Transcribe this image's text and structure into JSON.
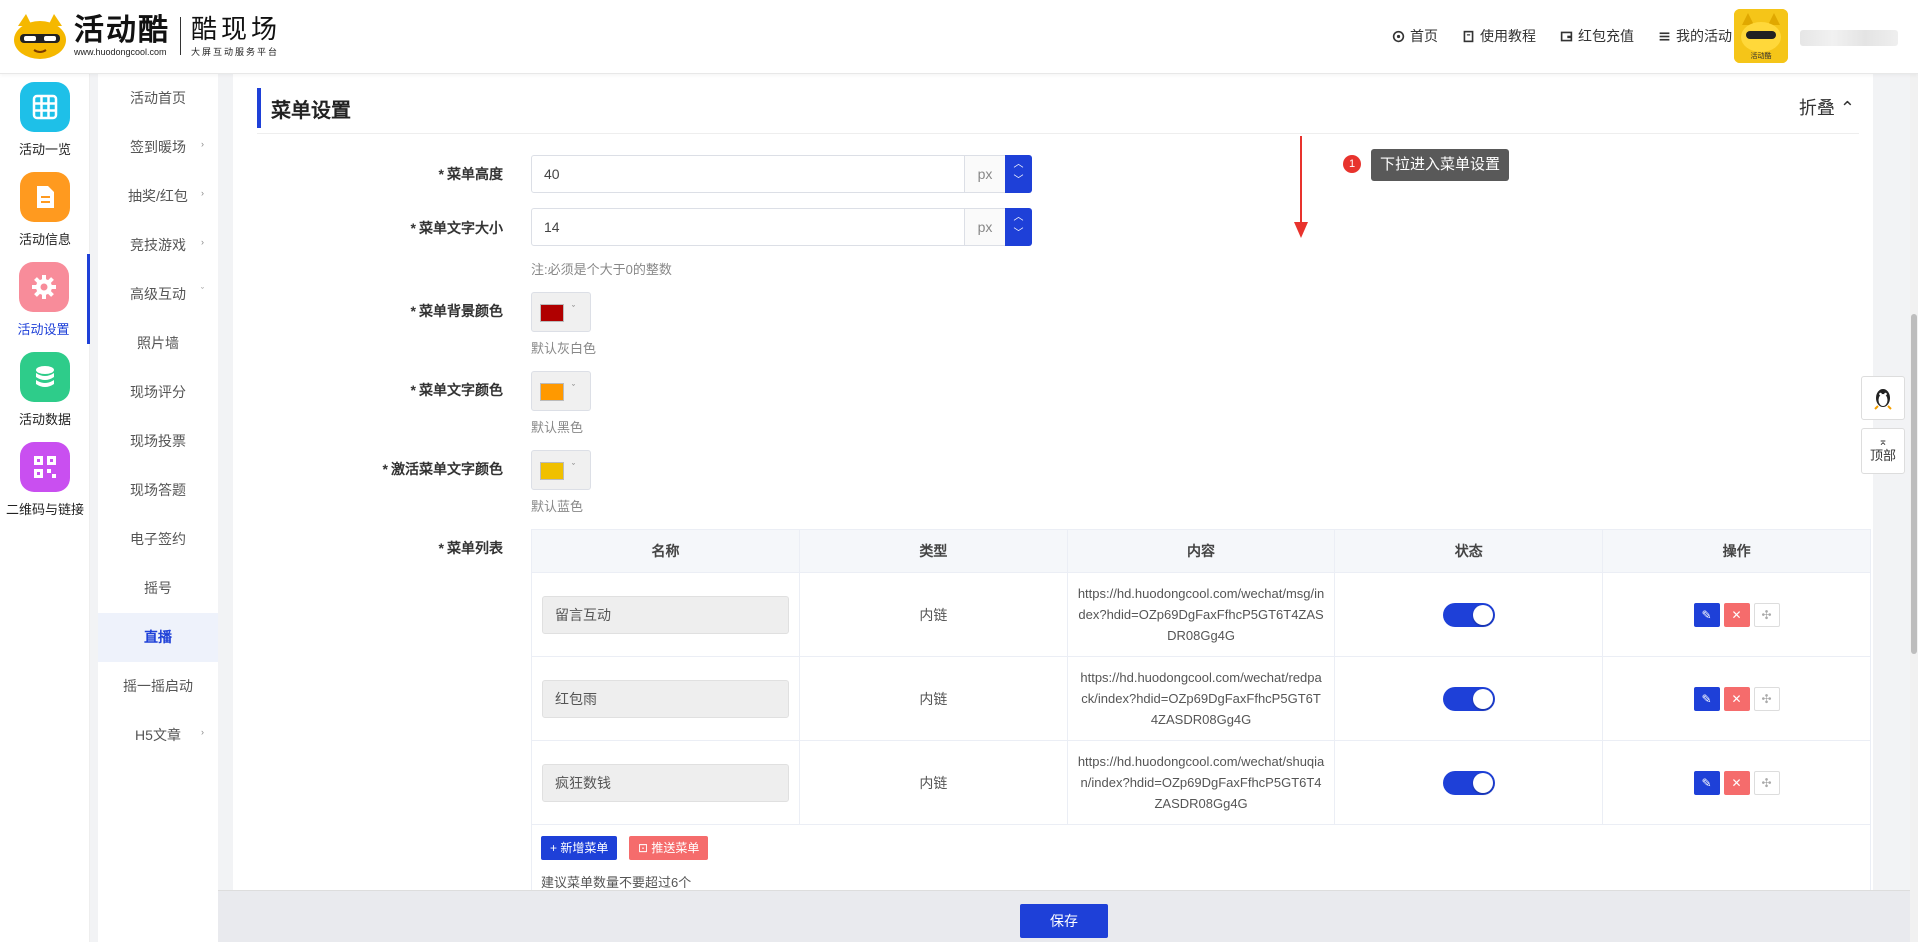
{
  "brand": {
    "name": "活动酷",
    "url": "www.huodongcool.com",
    "subname": "酷现场",
    "tagline": "大屏互动服务平台"
  },
  "topnav": [
    {
      "label": "首页",
      "icon": "home-icon"
    },
    {
      "label": "使用教程",
      "icon": "book-icon"
    },
    {
      "label": "红包充值",
      "icon": "wallet-icon"
    },
    {
      "label": "我的活动",
      "icon": "list-icon"
    }
  ],
  "avatar_label": "活动酷",
  "iconbar": [
    {
      "label": "活动一览",
      "color": "#1ec0e8"
    },
    {
      "label": "活动信息",
      "color": "#ff9a1f"
    },
    {
      "label": "活动设置",
      "color": "#f88c9a",
      "active": true
    },
    {
      "label": "活动数据",
      "color": "#2ecc8a"
    },
    {
      "label": "二维码与链接",
      "color": "#c94ff0"
    }
  ],
  "submenu": [
    {
      "label": "活动首页",
      "arrow": ""
    },
    {
      "label": "签到暖场",
      "arrow": "›"
    },
    {
      "label": "抽奖/红包",
      "arrow": "›"
    },
    {
      "label": "竞技游戏",
      "arrow": "›"
    },
    {
      "label": "高级互动",
      "arrow": "ˇ"
    },
    {
      "label": "照片墙",
      "arrow": ""
    },
    {
      "label": "现场评分",
      "arrow": ""
    },
    {
      "label": "现场投票",
      "arrow": ""
    },
    {
      "label": "现场答题",
      "arrow": ""
    },
    {
      "label": "电子签约",
      "arrow": ""
    },
    {
      "label": "摇号",
      "arrow": ""
    },
    {
      "label": "直播",
      "arrow": "",
      "active": true
    },
    {
      "label": "摇一摇启动",
      "arrow": ""
    },
    {
      "label": "H5文章",
      "arrow": "›"
    }
  ],
  "section": {
    "title": "菜单设置",
    "fold_label": "折叠 ⌃"
  },
  "form": {
    "menu_height": {
      "label": "菜单高度",
      "value": "40",
      "unit": "px"
    },
    "menu_font_size": {
      "label": "菜单文字大小",
      "value": "14",
      "unit": "px",
      "hint": "注:必须是个大于0的整数"
    },
    "menu_bg_color": {
      "label": "菜单背景颜色",
      "color": "#b00000",
      "hint": "默认灰白色"
    },
    "menu_text_color": {
      "label": "菜单文字颜色",
      "color": "#ff9900",
      "hint": "默认黑色"
    },
    "active_text_color": {
      "label": "激活菜单文字颜色",
      "color": "#f0c000",
      "hint": "默认蓝色"
    },
    "menu_list_label": "菜单列表"
  },
  "table": {
    "headers": [
      "名称",
      "类型",
      "内容",
      "状态",
      "操作"
    ],
    "rows": [
      {
        "name": "留言互动",
        "type": "内链",
        "content": "https://hd.huodongcool.com/wechat/msg/index?hdid=OZp69DgFaxFfhcP5GT6T4ZASDR08Gg4G",
        "enabled": true
      },
      {
        "name": "红包雨",
        "type": "内链",
        "content": "https://hd.huodongcool.com/wechat/redpack/index?hdid=OZp69DgFaxFfhcP5GT6T4ZASDR08Gg4G",
        "enabled": true
      },
      {
        "name": "疯狂数钱",
        "type": "内链",
        "content": "https://hd.huodongcool.com/wechat/shuqian/index?hdid=OZp69DgFaxFfhcP5GT6T4ZASDR08Gg4G",
        "enabled": true
      }
    ],
    "add_label": "+ 新增菜单",
    "push_label": "⊡ 推送菜单",
    "tip": "建议菜单数量不要超过6个"
  },
  "save_label": "保存",
  "annotation": {
    "step": "1",
    "text": "下拉进入菜单设置"
  },
  "float": {
    "top_label": "顶部"
  },
  "colors": {
    "accent": "#1e40d8",
    "danger": "#f56c6c"
  }
}
